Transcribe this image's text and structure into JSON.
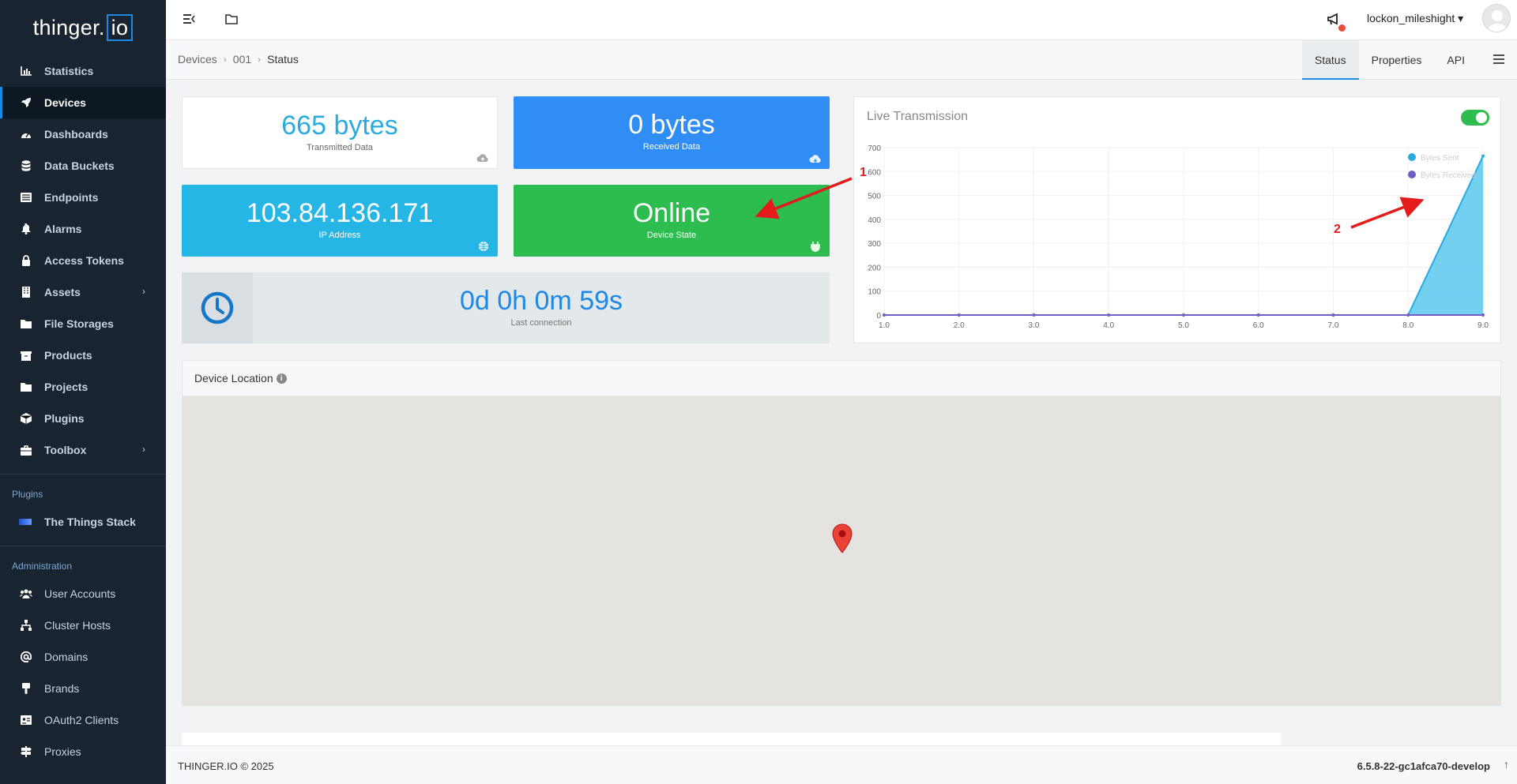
{
  "brand": {
    "text": "thinger.",
    "io": "io"
  },
  "sidebar": {
    "items": [
      {
        "label": "Statistics",
        "icon": "chart-icon"
      },
      {
        "label": "Devices",
        "icon": "rocket-icon",
        "active": true
      },
      {
        "label": "Dashboards",
        "icon": "gauge-icon"
      },
      {
        "label": "Data Buckets",
        "icon": "database-icon"
      },
      {
        "label": "Endpoints",
        "icon": "list-icon"
      },
      {
        "label": "Alarms",
        "icon": "bell-icon"
      },
      {
        "label": "Access Tokens",
        "icon": "lock-icon"
      },
      {
        "label": "Assets",
        "icon": "building-icon",
        "expandable": true
      },
      {
        "label": "File Storages",
        "icon": "folder-icon"
      },
      {
        "label": "Products",
        "icon": "box-icon"
      },
      {
        "label": "Projects",
        "icon": "folder-icon"
      },
      {
        "label": "Plugins",
        "icon": "cube-icon"
      },
      {
        "label": "Toolbox",
        "icon": "toolbox-icon",
        "expandable": true
      }
    ],
    "plugins_title": "Plugins",
    "plugins": [
      {
        "label": "The Things Stack"
      }
    ],
    "admin_title": "Administration",
    "admin": [
      {
        "label": "User Accounts",
        "icon": "users-icon"
      },
      {
        "label": "Cluster Hosts",
        "icon": "sitemap-icon"
      },
      {
        "label": "Domains",
        "icon": "at-icon"
      },
      {
        "label": "Brands",
        "icon": "brush-icon"
      },
      {
        "label": "OAuth2 Clients",
        "icon": "id-card-icon"
      },
      {
        "label": "Proxies",
        "icon": "signs-icon"
      }
    ]
  },
  "topbar": {
    "username": "lockon_mileshight"
  },
  "breadcrumb": {
    "items": [
      "Devices",
      "001"
    ],
    "current": "Status"
  },
  "tabs": [
    "Status",
    "Properties",
    "API"
  ],
  "cards": {
    "transmitted": {
      "value": "665 bytes",
      "label": "Transmitted Data"
    },
    "received": {
      "value": "0 bytes",
      "label": "Received Data"
    },
    "ip": {
      "value": "103.84.136.171",
      "label": "IP Address"
    },
    "state": {
      "value": "Online",
      "label": "Device State"
    },
    "connection": {
      "value": "0d 0h 0m 59s",
      "label": "Last connection"
    }
  },
  "live": {
    "title": "Live Transmission",
    "enabled": true
  },
  "chart_data": {
    "type": "area",
    "x": [
      1.0,
      2.0,
      3.0,
      4.0,
      5.0,
      6.0,
      7.0,
      8.0,
      9.0
    ],
    "series": [
      {
        "name": "Bytes Sent",
        "color": "#29abe2",
        "values": [
          0,
          0,
          0,
          0,
          0,
          0,
          0,
          0,
          665
        ]
      },
      {
        "name": "Bytes Received",
        "color": "#6f5cc4",
        "values": [
          0,
          0,
          0,
          0,
          0,
          0,
          0,
          0,
          0
        ]
      }
    ],
    "xticks": [
      "1.0",
      "2.0",
      "3.0",
      "4.0",
      "5.0",
      "6.0",
      "7.0",
      "8.0",
      "9.0"
    ],
    "yticks": [
      0,
      100,
      200,
      300,
      400,
      500,
      600,
      700
    ],
    "xlim": [
      1,
      9
    ],
    "ylim": [
      0,
      700
    ],
    "grid": true,
    "legend": "top-right"
  },
  "location": {
    "title": "Device Location",
    "info": "i"
  },
  "annotations": {
    "one": "1",
    "two": "2"
  },
  "footer": {
    "copyright": "THINGER.IO © 2025",
    "version": "6.5.8-22-gc1afca70-develop",
    "up": "↑"
  }
}
